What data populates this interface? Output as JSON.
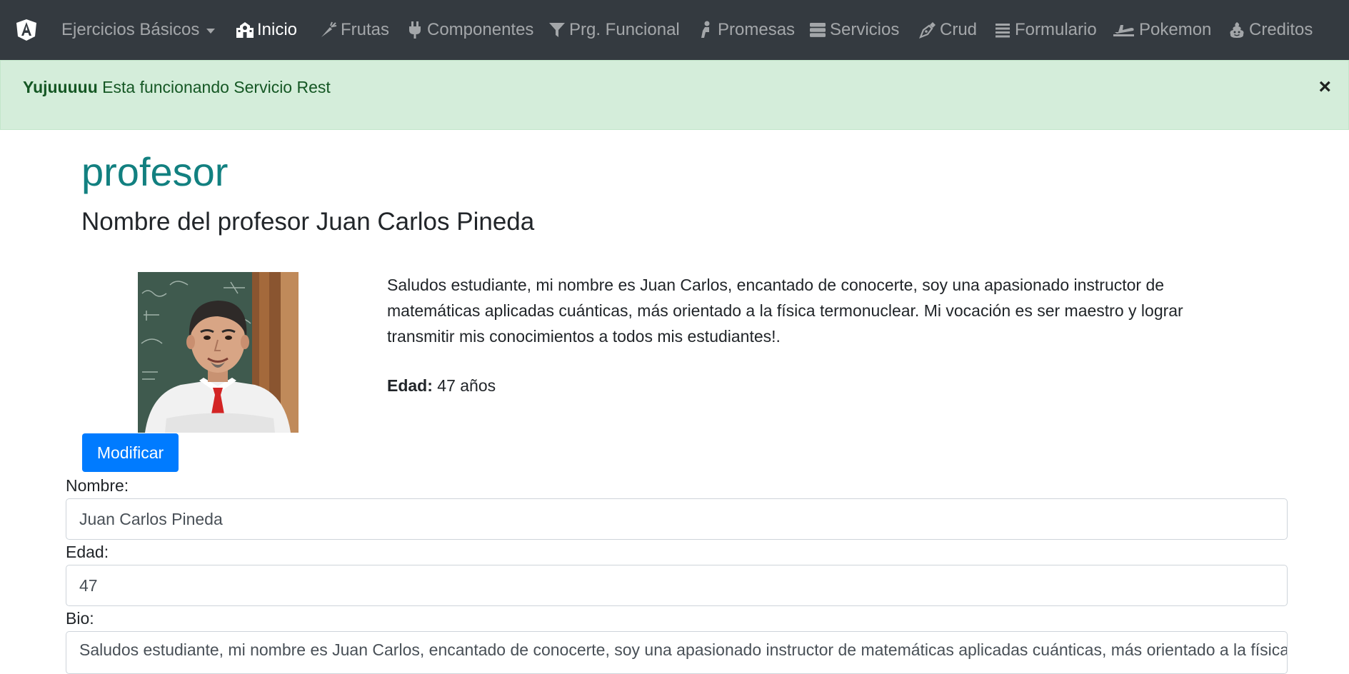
{
  "navbar": {
    "brand_icon": "angular-logo-icon",
    "items": [
      {
        "label": "Ejercicios Básicos",
        "icon": "dropdown-caret",
        "active": false
      },
      {
        "label": "Inicio",
        "icon": "school-icon",
        "active": true
      },
      {
        "label": "Frutas",
        "icon": "carrot-icon",
        "active": false
      },
      {
        "label": "Componentes",
        "icon": "plug-icon",
        "active": false
      },
      {
        "label": "Prg. Funcional",
        "icon": "filter-icon",
        "active": false
      },
      {
        "label": "Promesas",
        "icon": "person-kneeling-icon",
        "active": false
      },
      {
        "label": "Servicios",
        "icon": "server-icon",
        "active": false
      },
      {
        "label": "Crud",
        "icon": "pen-nib-icon",
        "active": false
      },
      {
        "label": "Formulario",
        "icon": "list-icon",
        "active": false
      },
      {
        "label": "Pokemon",
        "icon": "plane-icon",
        "active": false
      },
      {
        "label": "Creditos",
        "icon": "poop-icon",
        "active": false
      }
    ]
  },
  "alert": {
    "strong": "Yujuuuuu",
    "message": " Esta funcionando Servicio Rest",
    "close_label": "×"
  },
  "profile": {
    "title": "profesor",
    "subtitle": "Nombre del profesor Juan Carlos Pineda",
    "bio": "Saludos estudiante, mi nombre es Juan Carlos, encantado de conocerte, soy una apasionado instructor de matemáticas aplicadas cuánticas, más orientado a la física termonuclear. Mi vocación es ser maestro y lograr transmitir mis conocimientos a todos mis estudiantes!.",
    "age_label": "Edad:",
    "age_value": " 47 años",
    "modify_button": "Modificar"
  },
  "form": {
    "name_label": "Nombre:",
    "name_value": "Juan Carlos Pineda",
    "age_label": "Edad:",
    "age_value": "47",
    "bio_label": "Bio:",
    "bio_value": "Saludos estudiante, mi nombre es Juan Carlos, encantado de conocerte, soy una apasionado instructor de matemáticas aplicadas cuánticas, más orientado a la física termonuclear. Mi vocación es ser maestro y lograr transmitir mis conocimientos a todos mis estudiantes!."
  },
  "colors": {
    "navbar_bg": "#343a40",
    "alert_bg": "#d4edda",
    "alert_text": "#155724",
    "title": "#128080",
    "primary": "#007bff"
  }
}
